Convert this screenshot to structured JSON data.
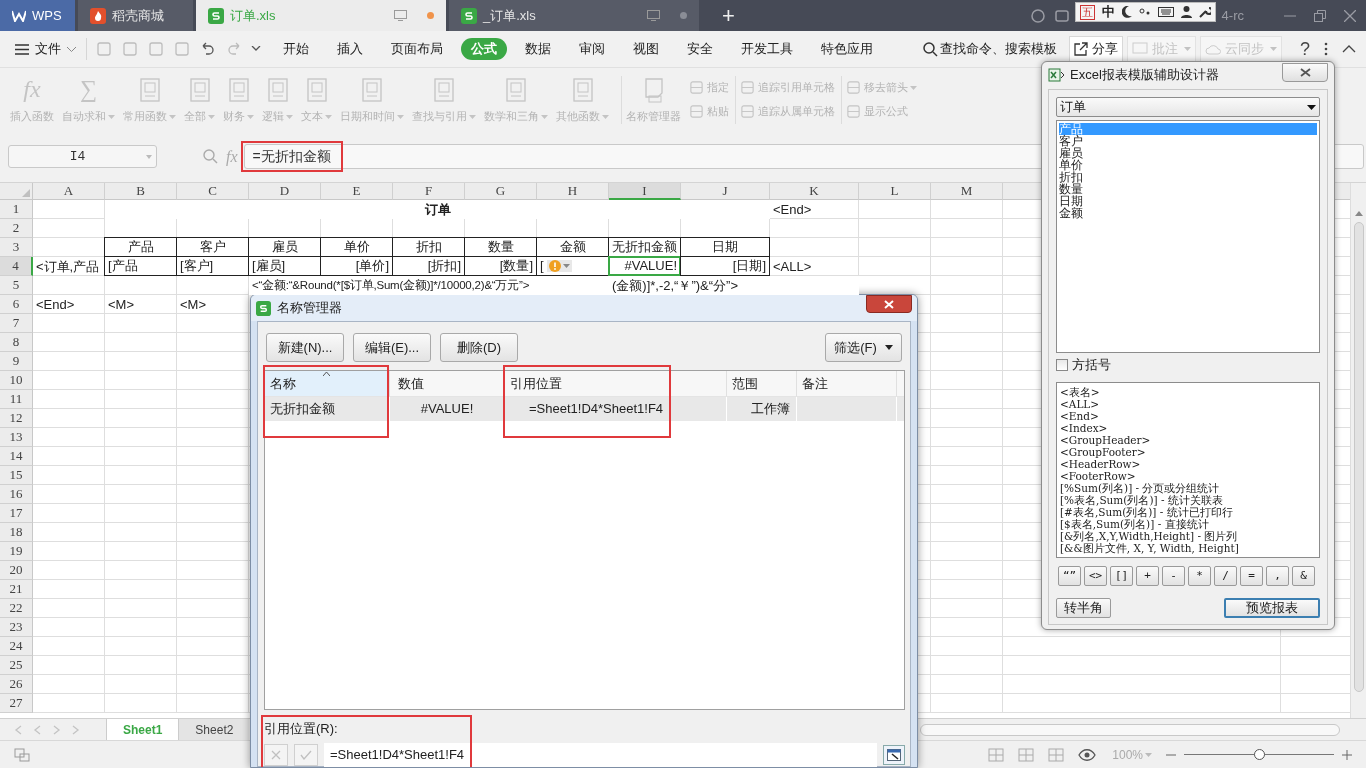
{
  "title_bar": {
    "tabs": [
      {
        "label": "WPS",
        "kind": "home",
        "selected": false
      },
      {
        "label": "稻壳商城",
        "kind": "store",
        "selected": false
      },
      {
        "label": "订单.xls",
        "kind": "sheet",
        "selected": true,
        "modified": true
      },
      {
        "label": "_订单.xls",
        "kind": "sheet",
        "selected": false,
        "modified": false
      }
    ],
    "new_tab": "+",
    "ime": [
      "五",
      "中"
    ],
    "version_text": "4-rc"
  },
  "menu": {
    "file": "文件",
    "tabs": [
      {
        "label": "开始",
        "selected": false
      },
      {
        "label": "插入",
        "selected": false
      },
      {
        "label": "页面布局",
        "selected": false
      },
      {
        "label": "公式",
        "selected": true
      },
      {
        "label": "数据",
        "selected": false
      },
      {
        "label": "审阅",
        "selected": false
      },
      {
        "label": "视图",
        "selected": false
      },
      {
        "label": "安全",
        "selected": false
      },
      {
        "label": "开发工具",
        "selected": false
      },
      {
        "label": "特色应用",
        "selected": false
      }
    ],
    "search": "查找命令、搜索模板",
    "share": "分享",
    "comment": {
      "label": "批注",
      "disabled": true
    },
    "sync": {
      "label": "云同步",
      "disabled": true
    },
    "help": "?"
  },
  "ribbon": {
    "disabled": true,
    "large": [
      {
        "label": "插入函数",
        "glyph": "fx",
        "dropdown": false
      },
      {
        "label": "自动求和",
        "glyph": "∑",
        "dropdown": true
      },
      {
        "label": "常用函数",
        "dropdown": true
      },
      {
        "label": "全部",
        "dropdown": true
      },
      {
        "label": "财务",
        "dropdown": true
      },
      {
        "label": "逻辑",
        "dropdown": true
      },
      {
        "label": "文本",
        "dropdown": true
      },
      {
        "label": "日期和时间",
        "dropdown": true
      },
      {
        "label": "查找与引用",
        "dropdown": true
      },
      {
        "label": "数学和三角",
        "dropdown": true
      },
      {
        "label": "其他函数",
        "dropdown": true
      },
      {
        "label": "名称管理器",
        "dropdown": false
      }
    ],
    "small": [
      {
        "label": "指定",
        "dropdown": false
      },
      {
        "label": "粘贴",
        "dropdown": false
      },
      {
        "label": "追踪引用单元格",
        "dropdown": false
      },
      {
        "label": "追踪从属单元格",
        "dropdown": false
      },
      {
        "label": "移去箭头",
        "dropdown": true
      },
      {
        "label": "显示公式",
        "dropdown": false
      }
    ]
  },
  "formula_bar": {
    "name_box": "I4",
    "fx": "fx",
    "formula": "=无折扣金额",
    "highlighted": true
  },
  "sheet": {
    "columns": [
      {
        "label": "A",
        "selected": false
      },
      {
        "label": "B",
        "selected": false
      },
      {
        "label": "C",
        "selected": false
      },
      {
        "label": "D",
        "selected": false
      },
      {
        "label": "E",
        "selected": false
      },
      {
        "label": "F",
        "selected": false
      },
      {
        "label": "G",
        "selected": false
      },
      {
        "label": "H",
        "selected": false
      },
      {
        "label": "I",
        "selected": true
      },
      {
        "label": "J",
        "selected": false
      },
      {
        "label": "K",
        "selected": false
      },
      {
        "label": "L",
        "selected": false
      },
      {
        "label": "M",
        "selected": false
      }
    ],
    "rows": [
      {
        "label": "1",
        "selected": false,
        "cells": {
          "B": {
            "text": "订单",
            "kind": "title",
            "bordered": false
          },
          "K": {
            "text": "<End>",
            "kind": "text",
            "bordered": false
          }
        }
      },
      {
        "label": "2",
        "selected": false
      },
      {
        "label": "3",
        "selected": false,
        "cells": {
          "B": {
            "text": "产品",
            "kind": "heading",
            "bordered": true
          },
          "C": {
            "text": "客户",
            "kind": "heading",
            "bordered": true
          },
          "D": {
            "text": "雇员",
            "kind": "heading",
            "bordered": true
          },
          "E": {
            "text": "单价",
            "kind": "heading",
            "bordered": true
          },
          "F": {
            "text": "折扣",
            "kind": "heading",
            "bordered": true
          },
          "G": {
            "text": "数量",
            "kind": "heading",
            "bordered": true
          },
          "H": {
            "text": "金额",
            "kind": "heading",
            "bordered": true
          },
          "I": {
            "text": "无折扣金额",
            "kind": "heading",
            "bordered": true
          },
          "J": {
            "text": "日期",
            "kind": "heading",
            "bordered": true
          }
        }
      },
      {
        "label": "4",
        "selected": true,
        "cells": {
          "A": {
            "text": "<订单,产品",
            "kind": "text",
            "bordered": false
          },
          "B": {
            "text": "[产品",
            "kind": "text",
            "bordered": true
          },
          "C": {
            "text": "[客户]",
            "kind": "text",
            "bordered": true
          },
          "D": {
            "text": "[雇员]",
            "kind": "text",
            "bordered": true
          },
          "E": {
            "text": "[单价]",
            "kind": "number",
            "bordered": true
          },
          "F": {
            "text": "[折扣]",
            "kind": "number",
            "bordered": true
          },
          "G": {
            "text": "[数量]",
            "kind": "number",
            "bordered": true
          },
          "H": {
            "text": "[",
            "kind": "text",
            "bordered": true,
            "warning": true
          },
          "I": {
            "text": "#VALUE!",
            "kind": "number",
            "bordered": true,
            "selected": true
          },
          "J": {
            "text": "[日期]",
            "kind": "number",
            "bordered": true
          },
          "K": {
            "text": "<ALL>",
            "kind": "text",
            "bordered": false
          }
        }
      },
      {
        "label": "5",
        "selected": false,
        "cells": {
          "D": {
            "text": "<“金额:“&Round(*[$订单,Sum(金额)]*/10000,2)&“万元”>",
            "kind": "text",
            "bordered": false
          },
          "I": {
            "text": "(金额)]*,-2,“￥”)&“分”>",
            "kind": "text",
            "bordered": false
          }
        }
      },
      {
        "label": "6",
        "selected": false,
        "cells": {
          "A": {
            "text": "<End>",
            "kind": "text",
            "bordered": false
          },
          "B": {
            "text": "<M>",
            "kind": "text",
            "bordered": false
          },
          "C": {
            "text": "<M>",
            "kind": "text",
            "bordered": false
          }
        }
      },
      {
        "label": "7",
        "selected": false
      },
      {
        "label": "8",
        "selected": false
      },
      {
        "label": "9",
        "selected": false
      },
      {
        "label": "10",
        "selected": false
      },
      {
        "label": "11",
        "selected": false
      },
      {
        "label": "12",
        "selected": false
      },
      {
        "label": "13",
        "selected": false
      },
      {
        "label": "14",
        "selected": false
      },
      {
        "label": "15",
        "selected": false
      },
      {
        "label": "16",
        "selected": false
      },
      {
        "label": "17",
        "selected": false
      },
      {
        "label": "18",
        "selected": false
      },
      {
        "label": "19",
        "selected": false
      },
      {
        "label": "20",
        "selected": false
      },
      {
        "label": "21",
        "selected": false
      },
      {
        "label": "22",
        "selected": false
      },
      {
        "label": "23",
        "selected": false
      },
      {
        "label": "24",
        "selected": false
      },
      {
        "label": "25",
        "selected": false
      },
      {
        "label": "26",
        "selected": false
      },
      {
        "label": "27",
        "selected": false
      }
    ],
    "sheet_tabs": [
      {
        "label": "Sheet1",
        "selected": true
      },
      {
        "label": "Sheet2",
        "selected": false
      }
    ]
  },
  "status_bar": {
    "zoom": "100%",
    "zoom_slider": {
      "level": 0.5
    }
  },
  "name_manager": {
    "title": "名称管理器",
    "buttons": [
      "新建(N)...",
      "编辑(E)...",
      "删除(D)"
    ],
    "filter": "筛选(F)",
    "columns": [
      {
        "label": "名称",
        "highlighted": true,
        "sorted": true
      },
      {
        "label": "数值",
        "highlighted": false,
        "sorted": false
      },
      {
        "label": "引用位置",
        "highlighted": true,
        "sorted": false
      },
      {
        "label": "范围",
        "highlighted": false,
        "sorted": false
      },
      {
        "label": "备注",
        "highlighted": false,
        "sorted": false
      }
    ],
    "rows": [
      {
        "selected": true,
        "cells": [
          "无折扣金额",
          "#VALUE!",
          "=Sheet1!D4*Sheet1!F4",
          "工作簿",
          ""
        ]
      }
    ],
    "refers_label": "引用位置(R):",
    "refers_value": "=Sheet1!D4*Sheet1!F4",
    "refers_highlighted": true,
    "edit_buttons_disabled": true
  },
  "designer": {
    "title": "Excel报表模版辅助设计器",
    "table": "订单",
    "fields": [
      {
        "label": "产品",
        "selected": true
      },
      {
        "label": "客户",
        "selected": false
      },
      {
        "label": "雇员",
        "selected": false
      },
      {
        "label": "单价",
        "selected": false
      },
      {
        "label": "折扣",
        "selected": false
      },
      {
        "label": "数量",
        "selected": false
      },
      {
        "label": "日期",
        "selected": false
      },
      {
        "label": "金额",
        "selected": false
      }
    ],
    "bracket": {
      "label": "方括号",
      "checked": false
    },
    "tokens": [
      "<表名>",
      "<ALL>",
      "<End>",
      "<Index>",
      "<GroupHeader>",
      "<GroupFooter>",
      "<HeaderRow>",
      "<FooterRow>",
      "[%Sum(列名)] - 分页或分组统计",
      "[%表名,Sum(列名)] - 统计关联表",
      "[#表名,Sum(列名)] - 统计已打印行",
      "[$表名,Sum(列名)] - 直接统计",
      "[&列名,X,Y,Width,Height] - 图片列",
      "[&&图片文件, X, Y, Width, Height]"
    ],
    "symbols": [
      "“”",
      "<>",
      "[]",
      "+",
      "-",
      "*",
      "/",
      "=",
      ",",
      "&"
    ],
    "buttons": [
      {
        "label": "转半角",
        "default": false
      },
      {
        "label": "预览报表",
        "default": true
      }
    ]
  }
}
